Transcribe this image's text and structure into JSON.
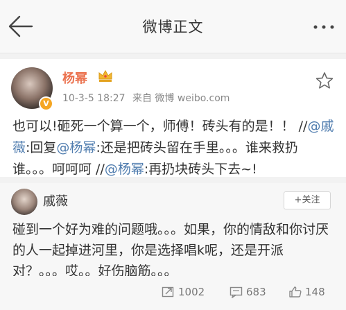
{
  "nav": {
    "title": "微博正文",
    "back_icon": "arrow-left-icon",
    "more_icon": "more-dots-icon"
  },
  "post": {
    "author": "杨幂",
    "meta_time": "10-3-5 18:27",
    "meta_source": "来自 微博 weibo.com",
    "segments": [
      "也可以!砸死一个算一个，师傅！砖头有的是！！ //",
      "@戚薇",
      ":回复",
      "@杨幂",
      ":还是把砖头留在手里。。。谁来救扔谁。。。呵呵呵 //",
      "@杨幂",
      ":再扔块砖头下去~!"
    ]
  },
  "quote": {
    "author": "戚薇",
    "follow_label": "+关注",
    "text": "碰到一个好为难的问题哦。。。如果，你的情敌和你讨厌的人一起掉进河里，你是选择唱k呢，还是开派对？。。。哎。。好伤脑筋。。。"
  },
  "stats": {
    "reposts": "1002",
    "comments": "683",
    "likes": "148"
  },
  "colors": {
    "author": "#eb7350",
    "mention": "#507daf",
    "badge": "#f5a623"
  }
}
